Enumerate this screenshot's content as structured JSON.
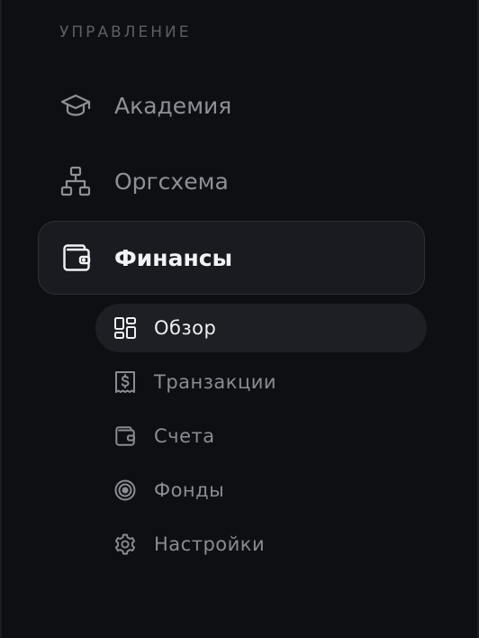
{
  "sidebar": {
    "section_label": "УПРАВЛЕНИЕ",
    "items": [
      {
        "label": "Академия",
        "icon": "graduation-cap-icon",
        "active": false
      },
      {
        "label": "Оргсхема",
        "icon": "org-chart-icon",
        "active": false
      },
      {
        "label": "Финансы",
        "icon": "wallet-icon",
        "active": true
      }
    ],
    "subitems": [
      {
        "label": "Обзор",
        "icon": "dashboard-grid-icon",
        "active": true
      },
      {
        "label": "Транзакции",
        "icon": "receipt-icon",
        "active": false
      },
      {
        "label": "Счета",
        "icon": "wallet-icon",
        "active": false
      },
      {
        "label": "Фонды",
        "icon": "target-icon",
        "active": false
      },
      {
        "label": "Настройки",
        "icon": "gear-icon",
        "active": false
      }
    ]
  },
  "colors": {
    "background": "#0e0f13",
    "active_bg": "#1a1b20",
    "text_muted": "#8e9098",
    "text_active": "#f2f3f5",
    "section_label": "#5c5e66"
  }
}
